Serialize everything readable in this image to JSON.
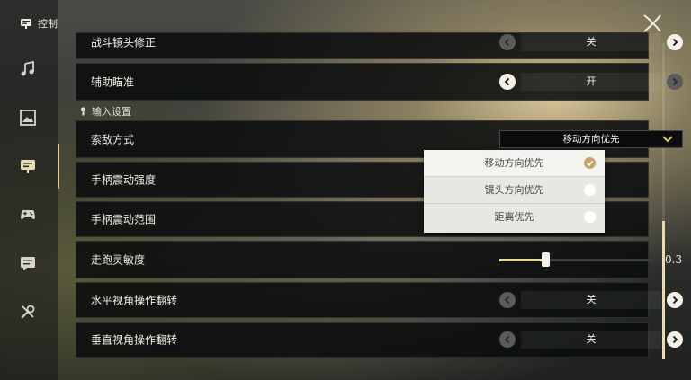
{
  "sidebar": {
    "title": "控制",
    "items": [
      {
        "icon": "music-note-icon"
      },
      {
        "icon": "image-icon"
      },
      {
        "icon": "control-icon",
        "active": true
      },
      {
        "icon": "gamepad-icon"
      },
      {
        "icon": "chat-icon"
      },
      {
        "icon": "tools-icon"
      }
    ]
  },
  "header": {
    "close_icon": "close-icon"
  },
  "rows": {
    "top_partial": {
      "label": "战斗镜头修正",
      "value": "关"
    },
    "aim_assist": {
      "label": "辅助瞄准",
      "value": "开"
    },
    "section_title": "输入设置",
    "target_mode": {
      "label": "索敌方式",
      "value": "移动方向优先"
    },
    "vibration_strength": {
      "label": "手柄震动强度"
    },
    "vibration_range": {
      "label": "手柄震动范围"
    },
    "run_sensitivity": {
      "label": "走跑灵敏度",
      "value": "0.3",
      "level": 0.3
    },
    "invert_horizontal": {
      "label": "水平视角操作翻转",
      "value": "关"
    },
    "invert_vertical": {
      "label": "垂直视角操作翻转",
      "value": "关"
    }
  },
  "dropdown": {
    "options": [
      {
        "label": "移动方向优先",
        "selected": true
      },
      {
        "label": "镜头方向优先",
        "selected": false
      },
      {
        "label": "距离优先",
        "selected": false
      }
    ]
  },
  "colors": {
    "accent": "#e7d9a8",
    "check": "#c4a46a"
  }
}
